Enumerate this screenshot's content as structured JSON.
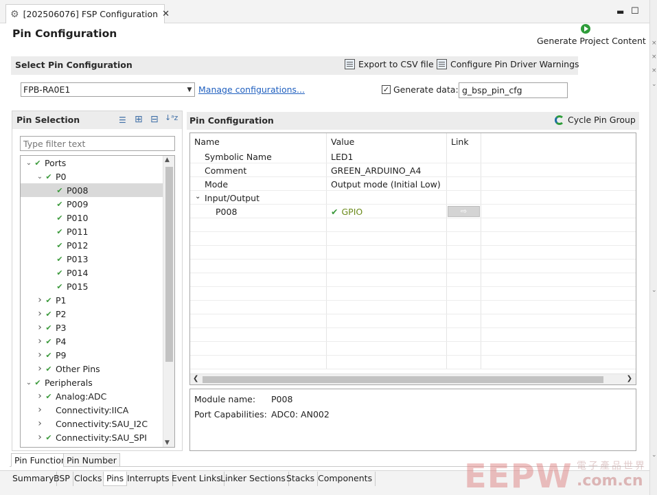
{
  "editor": {
    "tab_title": "[202506076] FSP Configuration",
    "page_title": "Pin Configuration",
    "generate_label": "Generate Project Content"
  },
  "select_bar": {
    "title": "Select Pin Configuration",
    "export_label": "Export to CSV file",
    "warnings_label": "Configure Pin Driver Warnings",
    "config_value": "FPB-RA0E1",
    "manage_link": "Manage configurations...",
    "generate_data_label": "Generate data:",
    "generate_data_checked": true,
    "generate_data_value": "g_bsp_pin_cfg"
  },
  "pin_selection": {
    "title": "Pin Selection",
    "filter_placeholder": "Type filter text",
    "tree": [
      {
        "label": "Ports",
        "level": 0,
        "expander": "down",
        "checked": true
      },
      {
        "label": "P0",
        "level": 1,
        "expander": "down",
        "checked": true
      },
      {
        "label": "P008",
        "level": 2,
        "expander": "",
        "checked": true,
        "selected": true
      },
      {
        "label": "P009",
        "level": 2,
        "expander": "",
        "checked": true
      },
      {
        "label": "P010",
        "level": 2,
        "expander": "",
        "checked": true
      },
      {
        "label": "P011",
        "level": 2,
        "expander": "",
        "checked": true
      },
      {
        "label": "P012",
        "level": 2,
        "expander": "",
        "checked": true
      },
      {
        "label": "P013",
        "level": 2,
        "expander": "",
        "checked": true
      },
      {
        "label": "P014",
        "level": 2,
        "expander": "",
        "checked": true
      },
      {
        "label": "P015",
        "level": 2,
        "expander": "",
        "checked": true
      },
      {
        "label": "P1",
        "level": 1,
        "expander": "right",
        "checked": true
      },
      {
        "label": "P2",
        "level": 1,
        "expander": "right",
        "checked": true
      },
      {
        "label": "P3",
        "level": 1,
        "expander": "right",
        "checked": true
      },
      {
        "label": "P4",
        "level": 1,
        "expander": "right",
        "checked": true
      },
      {
        "label": "P9",
        "level": 1,
        "expander": "right",
        "checked": true
      },
      {
        "label": "Other Pins",
        "level": 1,
        "expander": "right",
        "checked": true
      },
      {
        "label": "Peripherals",
        "level": 0,
        "expander": "down",
        "checked": true
      },
      {
        "label": "Analog:ADC",
        "level": 1,
        "expander": "right",
        "checked": true
      },
      {
        "label": "Connectivity:IICA",
        "level": 1,
        "expander": "right",
        "checked": false
      },
      {
        "label": "Connectivity:SAU_I2C",
        "level": 1,
        "expander": "right",
        "checked": false
      },
      {
        "label": "Connectivity:SAU_SPI",
        "level": 1,
        "expander": "right",
        "checked": true
      }
    ]
  },
  "pin_configuration": {
    "title": "Pin Configuration",
    "cycle_label": "Cycle Pin Group",
    "columns": [
      "Name",
      "Value",
      "Link"
    ],
    "rows": [
      {
        "name": "Symbolic Name",
        "value": "LED1",
        "indent": 1
      },
      {
        "name": "Comment",
        "value": "GREEN_ARDUINO_A4",
        "indent": 1
      },
      {
        "name": "Mode",
        "value": "Output mode (Initial Low)",
        "indent": 1
      },
      {
        "name": "Input/Output",
        "value": "",
        "indent": 0,
        "expander": "down"
      },
      {
        "name": "P008",
        "value": "GPIO",
        "indent": 2,
        "gpio": true,
        "link": true
      }
    ],
    "module_name_label": "Module name:",
    "module_name_value": "P008",
    "port_cap_label": "Port Capabilities:",
    "port_cap_value": "ADC0: AN002"
  },
  "pin_tabs": [
    "Pin Function",
    "Pin Number"
  ],
  "bottom_tabs": [
    "Summary",
    "BSP",
    "Clocks",
    "Pins",
    "Interrupts",
    "Event Links",
    "Linker Sections",
    "Stacks",
    "Components"
  ],
  "active_bottom_tab": "Pins",
  "watermark": {
    "logo": "EEPW",
    "line1": "電子產品世界",
    "line2": ".com.cn"
  },
  "colors": {
    "check_green": "#3c9a3c",
    "link_blue": "#1f5fbf",
    "gpio_olive": "#6a8a1a"
  }
}
